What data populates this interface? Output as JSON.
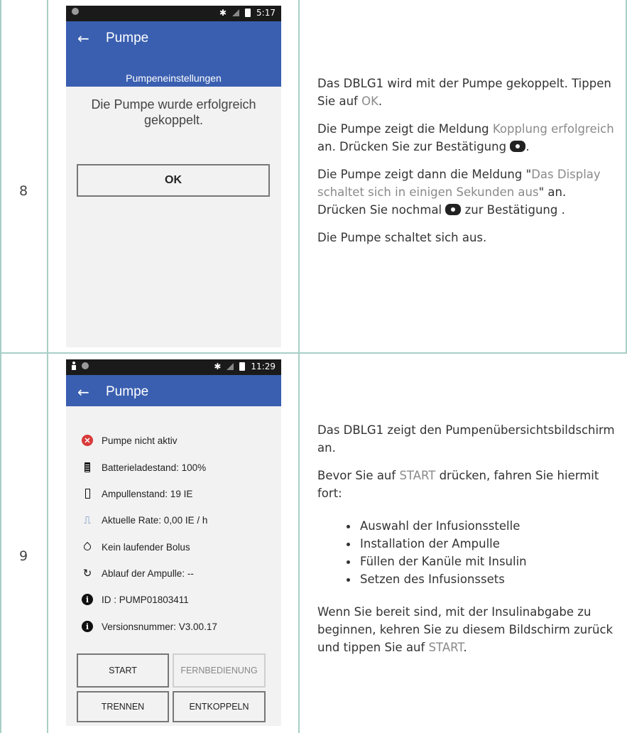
{
  "rows": [
    {
      "step": "8",
      "phone": {
        "status_time": "5:17",
        "title": "Pumpe",
        "subtitle": "Pumpeneinstellungen",
        "message": "Die Pumpe wurde erfolgreich gekoppelt.",
        "ok_label": "OK"
      },
      "text": {
        "p1_a": "Das DBLG1 wird mit der Pumpe gekoppelt. Tippen Sie auf ",
        "p1_hl": "OK",
        "p1_b": ".",
        "p2_a": "Die Pumpe zeigt die Meldung ",
        "p2_hl": "Kopplung erfolgreich",
        "p2_b": " an. Drücken Sie zur Bestätigung ",
        "p2_c": ".",
        "p3_a": "Die Pumpe zeigt dann die Meldung \"",
        "p3_hl": "Das Display schaltet sich in einigen Sekunden aus",
        "p3_b": "\" an.",
        "p3_c": "Drücken Sie nochmal ",
        "p3_d": " zur Bestätigung .",
        "p4": "Die Pumpe schaltet sich aus."
      }
    },
    {
      "step": "9",
      "phone": {
        "status_time": "11:29",
        "title": "Pumpe",
        "items": [
          {
            "icon": "error-icon",
            "label": "Pumpe nicht aktiv"
          },
          {
            "icon": "battery-icon",
            "label": "Batterieladestand: 100%"
          },
          {
            "icon": "ampoule-icon",
            "label": "Ampullenstand: 19 IE"
          },
          {
            "icon": "rate-icon",
            "label": "Aktuelle Rate: 0,00 IE / h"
          },
          {
            "icon": "drop-icon",
            "label": "Kein laufender Bolus"
          },
          {
            "icon": "timer-icon",
            "label": "Ablauf der Ampulle: --"
          },
          {
            "icon": "info-icon",
            "label": "ID : PUMP01803411"
          },
          {
            "icon": "info-icon",
            "label": "Versionsnummer: V3.00.17"
          }
        ],
        "buttons": {
          "start": "START",
          "remote": "FERNBEDIENUNG",
          "disconnect": "TRENNEN",
          "unpair": "ENTKOPPELN"
        }
      },
      "text": {
        "p1": "Das DBLG1 zeigt den Pumpenübersichtsbildschirm an.",
        "p2_a": "Bevor Sie auf ",
        "p2_hl": "START",
        "p2_b": " drücken, fahren Sie hiermit fort:",
        "bullets": [
          "Auswahl der Infusionsstelle",
          "Installation der Ampulle",
          "Füllen der Kanüle mit Insulin",
          "Setzen des Infusionssets"
        ],
        "p3_a": "Wenn Sie bereit sind, mit der Insulinabgabe zu beginnen, kehren Sie zu diesem Bildschirm zurück und tippen Sie auf ",
        "p3_hl": "START",
        "p3_b": "."
      }
    }
  ],
  "colors": {
    "appbar": "#3a5fb0",
    "table_border": "#a8cfc6",
    "highlight_text": "#8a8a8a",
    "error": "#d93a3a"
  }
}
